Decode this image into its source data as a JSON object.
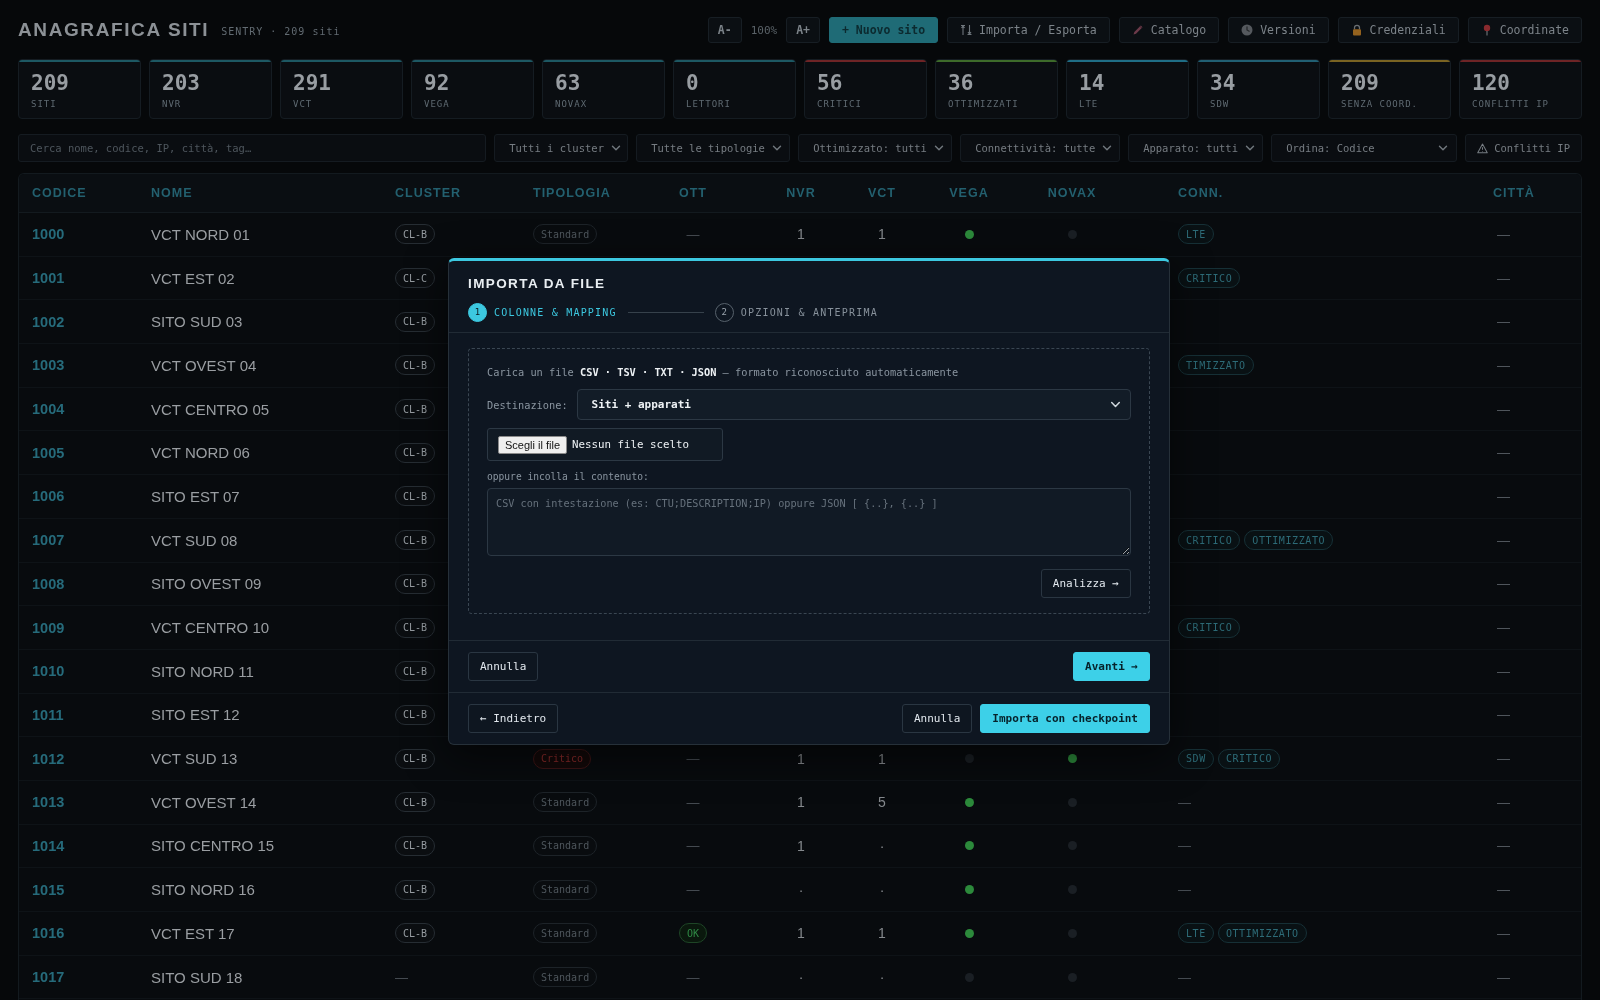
{
  "header": {
    "title": "ANAGRAFICA SITI",
    "subtitle": "SENTRY · 209 siti",
    "font_smaller": "A-",
    "zoom": "100%",
    "font_larger": "A+",
    "new_button": "+ Nuovo sito",
    "tools": [
      "Importa / Esporta",
      "Catalogo",
      "Versioni",
      "Credenziali",
      "Coordinate"
    ]
  },
  "stats": [
    {
      "value": "209",
      "label": "SITI",
      "color": "#1d5863"
    },
    {
      "value": "203",
      "label": "NVR",
      "color": "#1d5863"
    },
    {
      "value": "291",
      "label": "VCT",
      "color": "#1d5863"
    },
    {
      "value": "92",
      "label": "VEGA",
      "color": "#1d5863"
    },
    {
      "value": "63",
      "label": "NOVAX",
      "color": "#1d5863"
    },
    {
      "value": "0",
      "label": "LETTORI",
      "color": "#1d5863"
    },
    {
      "value": "56",
      "label": "CRITICI",
      "color": "#6e2426"
    },
    {
      "value": "36",
      "label": "OTTIMIZZATI",
      "color": "#3d6a2a"
    },
    {
      "value": "14",
      "label": "LTE",
      "color": "#1f6d86"
    },
    {
      "value": "34",
      "label": "SDW",
      "color": "#215f73"
    },
    {
      "value": "209",
      "label": "SENZA COORD.",
      "color": "#7a6322"
    },
    {
      "value": "120",
      "label": "CONFLITTI IP",
      "color": "#6e2426"
    }
  ],
  "filters": {
    "search_placeholder": "Cerca nome, codice, IP, città, tag…",
    "selects": [
      "Tutti i cluster",
      "Tutte le tipologie",
      "Ottimizzato: tutti",
      "Connettività: tutte",
      "Apparato: tutti",
      "Ordina: Codice"
    ],
    "conflicts_button": "Conflitti IP"
  },
  "table": {
    "columns": [
      "CODICE",
      "NOME",
      "CLUSTER",
      "TIPOLOGIA",
      "OTT",
      "NVR",
      "VCT",
      "VEGA",
      "NOVAX",
      "CONN.",
      "CITTÀ"
    ],
    "rows": [
      {
        "code": "1000",
        "name": "VCT NORD 01",
        "cluster": {
          "kind": "badge",
          "label": "CL-B"
        },
        "type": {
          "label": "Standard",
          "critical": false
        },
        "ott": {
          "kind": "text",
          "label": "—"
        },
        "nvr": "1",
        "vct": "1",
        "vega": true,
        "novax": false,
        "conn": {
          "kind": "tags",
          "tags": [
            "LTE"
          ]
        },
        "city": "—"
      },
      {
        "code": "1001",
        "name": "VCT EST 02",
        "cluster": {
          "kind": "badge",
          "label": "CL-C"
        },
        "conn": {
          "kind": "tags",
          "tags": [
            "CRITICO"
          ]
        },
        "city": "—"
      },
      {
        "code": "1002",
        "name": "SITO SUD 03",
        "cluster": {
          "kind": "badge",
          "label": "CL-B"
        },
        "city": "—"
      },
      {
        "code": "1003",
        "name": "VCT OVEST 04",
        "cluster": {
          "kind": "badge",
          "label": "CL-B"
        },
        "conn": {
          "kind": "tags",
          "tags": [
            "TIMIZZATO"
          ]
        },
        "city": "—"
      },
      {
        "code": "1004",
        "name": "VCT CENTRO 05",
        "cluster": {
          "kind": "badge",
          "label": "CL-B"
        },
        "city": "—"
      },
      {
        "code": "1005",
        "name": "VCT NORD 06",
        "cluster": {
          "kind": "badge",
          "label": "CL-B"
        },
        "city": "—"
      },
      {
        "code": "1006",
        "name": "SITO EST 07",
        "cluster": {
          "kind": "badge",
          "label": "CL-B"
        },
        "city": "—"
      },
      {
        "code": "1007",
        "name": "VCT SUD 08",
        "cluster": {
          "kind": "badge",
          "label": "CL-B"
        },
        "conn": {
          "kind": "tags",
          "tags": [
            "CRITICO",
            "OTTIMIZZATO"
          ]
        },
        "city": "—"
      },
      {
        "code": "1008",
        "name": "SITO OVEST 09",
        "cluster": {
          "kind": "badge",
          "label": "CL-B"
        },
        "city": "—"
      },
      {
        "code": "1009",
        "name": "VCT CENTRO 10",
        "cluster": {
          "kind": "badge",
          "label": "CL-B"
        },
        "conn": {
          "kind": "tags",
          "tags": [
            "CRITICO"
          ]
        },
        "city": "—"
      },
      {
        "code": "1010",
        "name": "SITO NORD 11",
        "cluster": {
          "kind": "badge",
          "label": "CL-B"
        },
        "city": "—"
      },
      {
        "code": "1011",
        "name": "SITO EST 12",
        "cluster": {
          "kind": "badge",
          "label": "CL-B"
        },
        "city": "—"
      },
      {
        "code": "1012",
        "name": "VCT SUD 13",
        "cluster": {
          "kind": "badge",
          "label": "CL-B"
        },
        "type": {
          "label": "Critico",
          "critical": true
        },
        "ott": {
          "kind": "text",
          "label": "—"
        },
        "nvr": "1",
        "vct": "1",
        "vega": false,
        "novax": true,
        "conn": {
          "kind": "tags",
          "tags": [
            "SDW",
            "CRITICO"
          ]
        },
        "city": "—"
      },
      {
        "code": "1013",
        "name": "VCT OVEST 14",
        "cluster": {
          "kind": "badge",
          "label": "CL-B"
        },
        "type": {
          "label": "Standard",
          "critical": false
        },
        "ott": {
          "kind": "text",
          "label": "—"
        },
        "nvr": "1",
        "vct": "5",
        "vega": true,
        "novax": false,
        "conn": {
          "kind": "text",
          "label": "—"
        },
        "city": "—"
      },
      {
        "code": "1014",
        "name": "SITO CENTRO 15",
        "cluster": {
          "kind": "badge",
          "label": "CL-B"
        },
        "type": {
          "label": "Standard",
          "critical": false
        },
        "ott": {
          "kind": "text",
          "label": "—"
        },
        "nvr": "1",
        "vct": "·",
        "vega": true,
        "novax": false,
        "conn": {
          "kind": "text",
          "label": "—"
        },
        "city": "—"
      },
      {
        "code": "1015",
        "name": "SITO NORD 16",
        "cluster": {
          "kind": "badge",
          "label": "CL-B"
        },
        "type": {
          "label": "Standard",
          "critical": false
        },
        "ott": {
          "kind": "text",
          "label": "—"
        },
        "nvr": "·",
        "vct": "·",
        "vega": true,
        "novax": false,
        "conn": {
          "kind": "text",
          "label": "—"
        },
        "city": "—"
      },
      {
        "code": "1016",
        "name": "VCT EST 17",
        "cluster": {
          "kind": "badge",
          "label": "CL-B"
        },
        "type": {
          "label": "Standard",
          "critical": false
        },
        "ott": {
          "kind": "badge",
          "label": "OK"
        },
        "nvr": "1",
        "vct": "1",
        "vega": true,
        "novax": false,
        "conn": {
          "kind": "tags",
          "tags": [
            "LTE",
            "OTTIMIZZATO"
          ]
        },
        "city": "—"
      },
      {
        "code": "1017",
        "name": "SITO SUD 18",
        "cluster": {
          "kind": "text",
          "label": "—"
        },
        "type": {
          "label": "Standard",
          "critical": false
        },
        "ott": {
          "kind": "text",
          "label": "—"
        },
        "nvr": "·",
        "vct": "·",
        "vega": false,
        "novax": false,
        "conn": {
          "kind": "text",
          "label": "—"
        },
        "city": "—"
      }
    ]
  },
  "modal": {
    "title": "IMPORTA DA FILE",
    "steps": [
      {
        "number": "1",
        "label": "COLONNE & MAPPING",
        "selected": true
      },
      {
        "number": "2",
        "label": "OPZIONI & ANTEPRIMA",
        "selected": false
      }
    ],
    "intro": "Carica un file **CSV · TSV · TXT · JSON** — formato riconosciuto automaticamente",
    "destination": {
      "label": "Destinazione:",
      "value": "Siti + apparati"
    },
    "file": {
      "button": "Scegli il file",
      "status": "Nessun file scelto"
    },
    "paste": {
      "label": "oppure incolla il contenuto:",
      "placeholder": "CSV con intestazione (es: CTU;DESCRIPTION;IP) oppure JSON [ {..}, {..} ]"
    },
    "analyze_button": "Analizza →",
    "footer": {
      "cancel": "Annulla",
      "next": "Avanti →"
    },
    "actions": {
      "back": "← Indietro",
      "cancel": "Annulla",
      "import": "Importa con checkpoint"
    }
  }
}
